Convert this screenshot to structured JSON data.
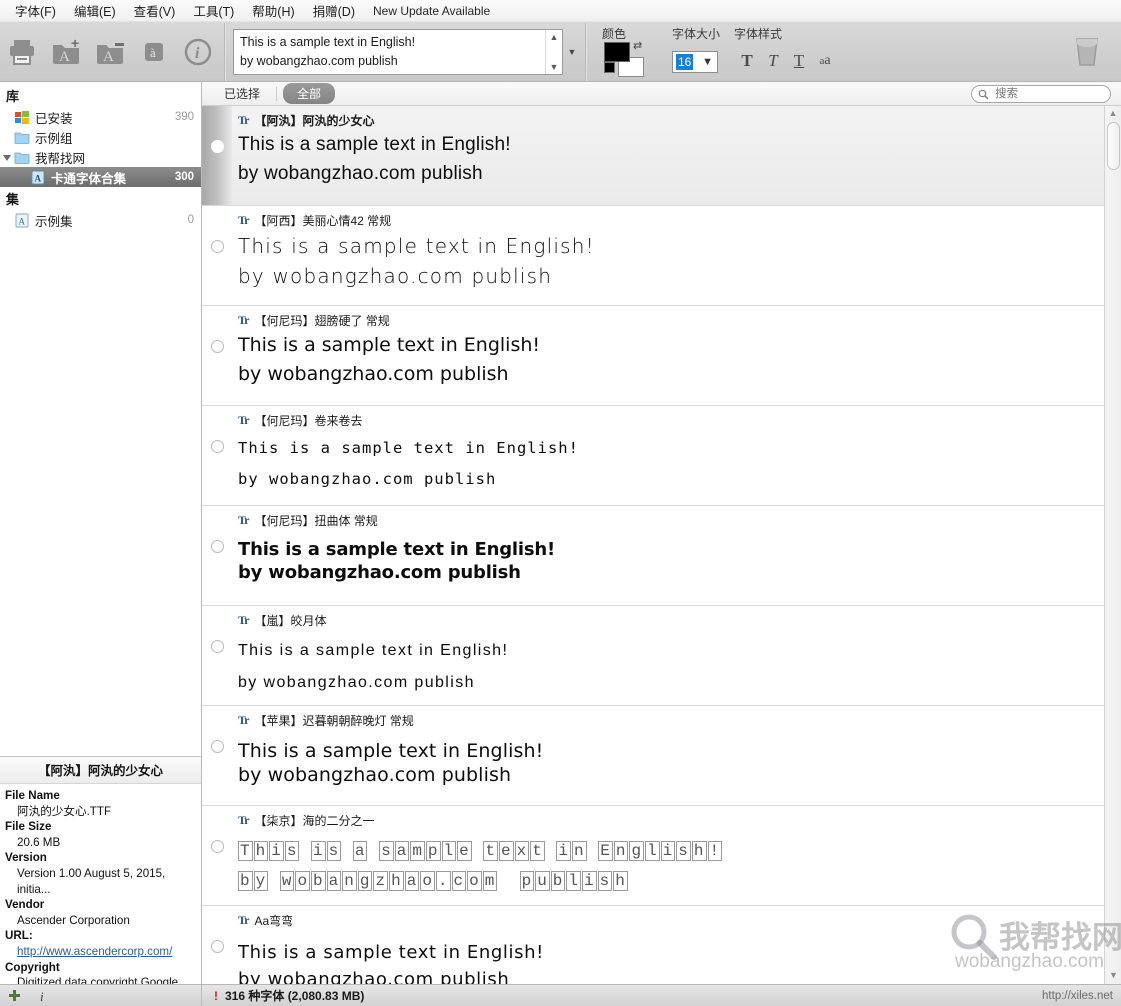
{
  "menubar": {
    "items": [
      {
        "label": "字体(F)",
        "name": "menu-font"
      },
      {
        "label": "编辑(E)",
        "name": "menu-edit"
      },
      {
        "label": "查看(V)",
        "name": "menu-view"
      },
      {
        "label": "工具(T)",
        "name": "menu-tools"
      },
      {
        "label": "帮助(H)",
        "name": "menu-help"
      },
      {
        "label": "捐赠(D)",
        "name": "menu-donate"
      }
    ],
    "update_notice": "New Update Available"
  },
  "toolbar": {
    "icons": [
      {
        "name": "print-icon",
        "glyph": "print"
      },
      {
        "name": "add-font-folder-icon",
        "glyph": "folder-plus"
      },
      {
        "name": "remove-font-folder-icon",
        "glyph": "folder-minus"
      },
      {
        "name": "character-map-icon",
        "glyph": "a-accent"
      },
      {
        "name": "info-icon",
        "glyph": "info"
      }
    ],
    "sample_text": "This is a sample text in English!\nby wobangzhao.com  publish",
    "color_label": "颜色",
    "size_label": "字体大小",
    "style_label": "字体样式",
    "font_size": "16",
    "foreground_color": "#000000",
    "background_color": "#ffffff",
    "style_buttons": [
      {
        "name": "bold-button",
        "glyph": "T"
      },
      {
        "name": "italic-button",
        "glyph": "T"
      },
      {
        "name": "underline-button",
        "glyph": "T"
      },
      {
        "name": "size-toggle-button",
        "glyph": "aa"
      }
    ],
    "trash_name": "delete-button"
  },
  "sidebar": {
    "library_header": "库",
    "library_items": [
      {
        "label": "已安装",
        "count": "390",
        "icon": "windows-icon",
        "indent": 1,
        "selected": false,
        "caret": ""
      },
      {
        "label": "示例组",
        "count": "",
        "icon": "folder-icon",
        "indent": 1,
        "selected": false,
        "caret": ""
      },
      {
        "label": "我帮找网",
        "count": "",
        "icon": "folder-icon",
        "indent": 1,
        "selected": false,
        "caret": "open"
      },
      {
        "label": "卡通字体合集",
        "count": "300",
        "icon": "font-set-icon",
        "indent": 2,
        "selected": true,
        "caret": ""
      }
    ],
    "sets_header": "集",
    "set_items": [
      {
        "label": "示例集",
        "count": "0",
        "icon": "font-set-icon",
        "indent": 1,
        "selected": false,
        "caret": ""
      }
    ]
  },
  "info_panel": {
    "title": "【阿汍】阿汍的少女心",
    "fields": [
      {
        "key": "File Name",
        "value": "阿汍的少女心.TTF",
        "link": false
      },
      {
        "key": "File Size",
        "value": "20.6 MB",
        "link": false
      },
      {
        "key": "Version",
        "value": "Version 1.00 August 5, 2015, initia...",
        "link": false
      },
      {
        "key": "Vendor",
        "value": "Ascender Corporation",
        "link": false
      },
      {
        "key": "URL:",
        "value": "http://www.ascendercorp.com/",
        "link": true
      },
      {
        "key": "Copyright",
        "value": "Digitized data copyright Google ...",
        "link": false
      }
    ]
  },
  "list_header": {
    "selected_tab": "已选择",
    "all_tab": "全部",
    "search_placeholder": "搜索",
    "search_value": ""
  },
  "font_rows": [
    {
      "name": "【阿汍】阿汍的少女心",
      "line1": "This is a sample text in English!",
      "line2": "by wobangzhao.com  publish",
      "selected": true
    },
    {
      "name": "【阿西】美丽心情42 常规",
      "line1": "This is a sample text in English!",
      "line2": "by wobangzhao.com  publish",
      "selected": false
    },
    {
      "name": "【何尼玛】翅膀硬了 常规",
      "line1": "This is a sample text in English!",
      "line2": "by wobangzhao.com  publish",
      "selected": false
    },
    {
      "name": "【何尼玛】卷来卷去",
      "line1": "This is a sample text in English!",
      "line2": "by wobangzhao.com   publish",
      "selected": false
    },
    {
      "name": "【何尼玛】扭曲体 常规",
      "line1": "This is a sample text in English!",
      "line2": "by wobangzhao.com  publish",
      "selected": false
    },
    {
      "name": "【嵐】皎月体",
      "line1": "This is a sample text in English!",
      "line2": "by wobangzhao.com   publish",
      "selected": false
    },
    {
      "name": "【苹果】迟暮朝朝醉晚灯 常规",
      "line1": "This is a sample text in English!",
      "line2": "by wobangzhao.com  publish",
      "selected": false
    },
    {
      "name": "【柒京】海的二分之一",
      "line1": "This is a sample text in English!",
      "line2": "by wobangzhao.com  publish",
      "selected": false
    },
    {
      "name": "Aa弯弯",
      "line1": "This is a sample text in English!",
      "line2": "by wobangzhao.com  publish",
      "selected": false
    }
  ],
  "statusbar": {
    "add_icon": "plus-icon",
    "info_icon": "info-icon",
    "warning_icon": "warning-icon",
    "count_text": "316 种字体 (2,080.83 MB)",
    "url": "http://xiles.net"
  },
  "watermark": {
    "chinese": "我帮找网",
    "english": "wobangzhao.com"
  },
  "colors": {
    "accent_blue": "#1c7fd4",
    "tt_icon_blue": "#2d4f86",
    "warning_red": "#d02020",
    "link_blue": "#2b5d93",
    "selected_gray": "#7d7d7d"
  }
}
